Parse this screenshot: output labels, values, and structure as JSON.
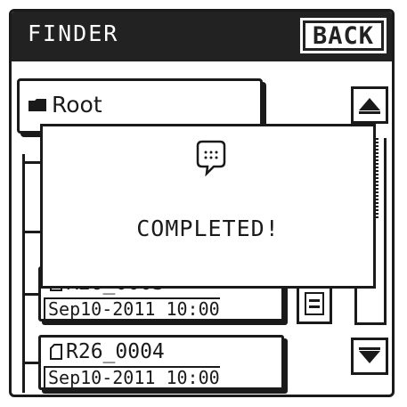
{
  "header": {
    "title": "FINDER",
    "back_label": "BACK"
  },
  "tree": {
    "root_label": "Root",
    "files": [
      {
        "name": "R26_0003",
        "date": "Sep10-2011 10:00"
      },
      {
        "name": "R26_0004",
        "date": "Sep10-2011 10:00"
      }
    ]
  },
  "dialog": {
    "message": "COMPLETED!",
    "icon": "speech-bubble-icon"
  },
  "scrollbar": {
    "up_icon": "arrow-up-icon",
    "down_icon": "arrow-down-icon"
  },
  "colors": {
    "foreground": "#1a1a1a",
    "header_bg": "#222222",
    "background": "#ffffff"
  }
}
